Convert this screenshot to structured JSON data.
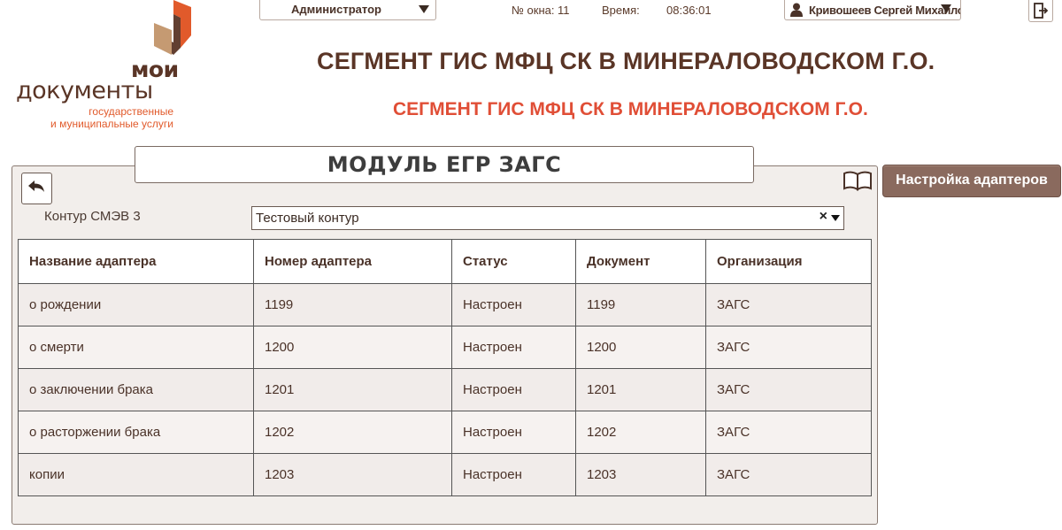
{
  "logo": {
    "line1": "мои",
    "line2": "документы",
    "tagline1": "государственные",
    "tagline2": "и муниципальные услуги",
    "colors": {
      "brown": "#5a3526",
      "orange": "#e15a2b",
      "tan": "#c59a72"
    }
  },
  "topbar": {
    "role": "Администратор",
    "window_label": "№ окна:",
    "window_value": "11",
    "time_label": "Время:",
    "time_value": "08:36:01",
    "user": "Кривошеев Сергей Михайлов",
    "icons": {
      "role_dropdown": "chevron-down-icon",
      "user": "user-icon",
      "exit": "exit-icon"
    }
  },
  "titles": {
    "main": "СЕГМЕНТ ГИС МФЦ СК В МИНЕРАЛОВОДСКОМ Г.О.",
    "sub": "СЕГМЕНТ ГИС МФЦ СК В МИНЕРАЛОВОДСКОМ Г.О."
  },
  "module": {
    "title": "МОДУЛЬ ЕГР ЗАГС",
    "settings_button": "Настройка адаптеров",
    "contour_label": "Контур СМЭВ 3",
    "contour_value": "Тестовый контур",
    "clear_symbol": "×",
    "icons": {
      "back": "back-arrow-icon",
      "help": "book-icon"
    }
  },
  "table": {
    "headers": [
      "Название адаптера",
      "Номер адаптера",
      "Статус",
      "Документ",
      "Организация"
    ],
    "rows": [
      [
        "о рождении",
        "1199",
        "Настроен",
        "1199",
        "ЗАГС"
      ],
      [
        "о смерти",
        "1200",
        "Настроен",
        "1200",
        "ЗАГС"
      ],
      [
        "о заключении брака",
        "1201",
        "Настроен",
        "1201",
        "ЗАГС"
      ],
      [
        "о расторжении брака",
        "1202",
        "Настроен",
        "1202",
        "ЗАГС"
      ],
      [
        "копии",
        "1203",
        "Настроен",
        "1203",
        "ЗАГС"
      ]
    ]
  },
  "colors": {
    "accent_brown": "#5a3526",
    "subtitle_red": "#e04e36",
    "button_brown": "#8a6a5e",
    "panel_bg": "#f2eeeb"
  }
}
